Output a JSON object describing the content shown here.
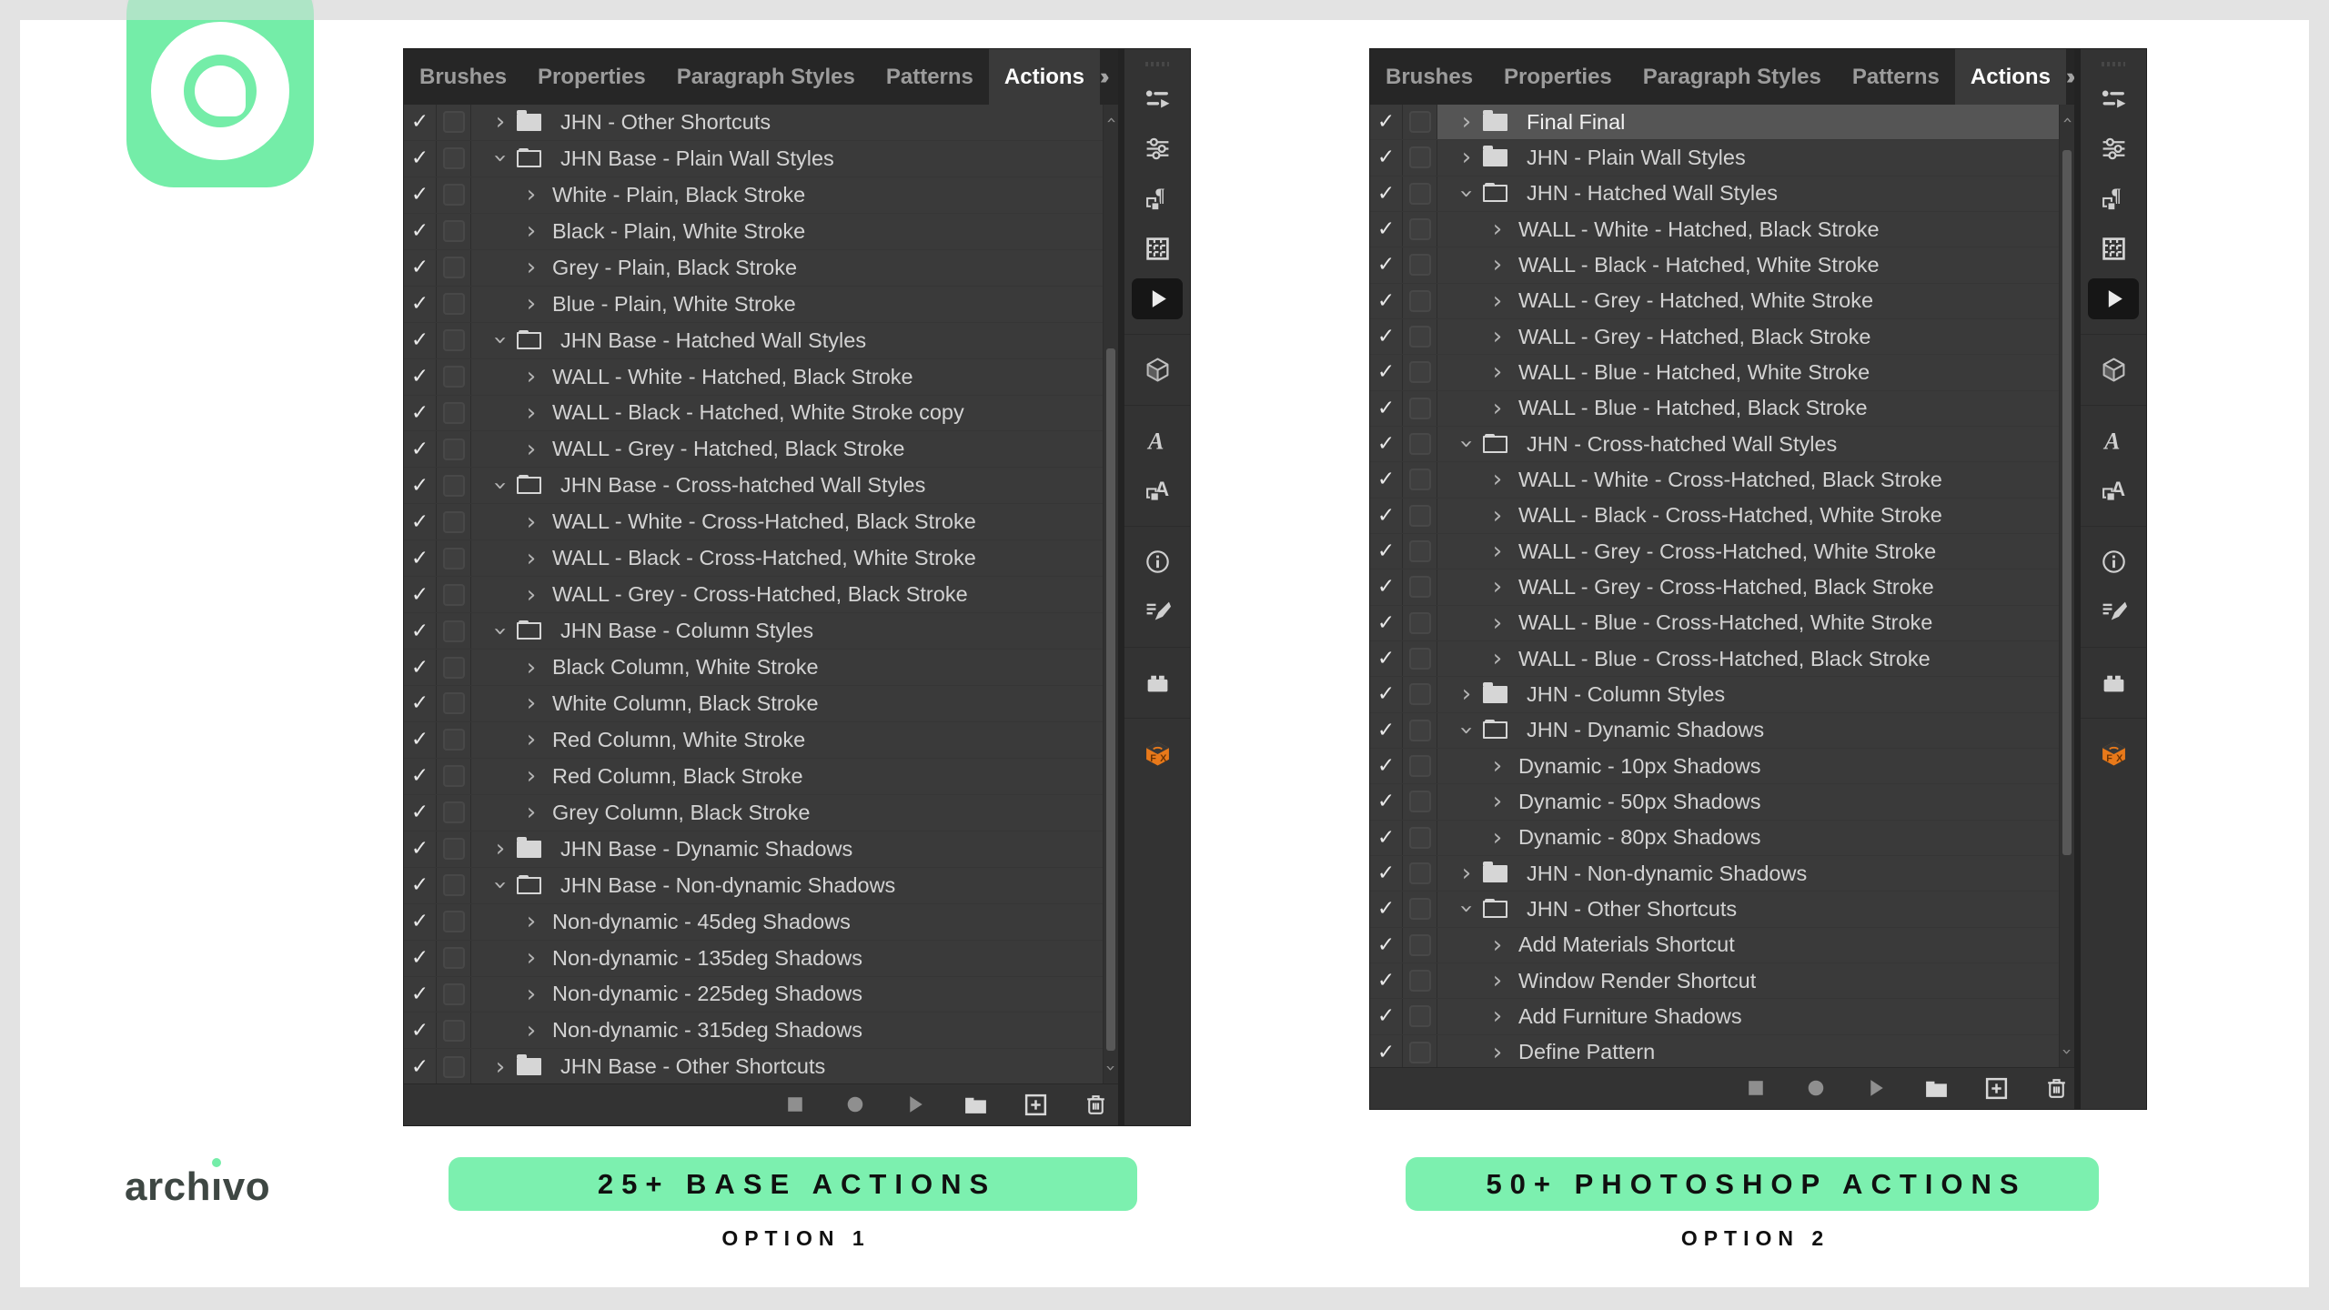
{
  "colors": {
    "green_button": "#7CF0AF",
    "green_icon": "#74EDA8",
    "panel_bg": "#3A3A3A",
    "tabbar_bg": "#262626",
    "toolstrip_bg": "#333333",
    "frame_grey": "#E3E3E3",
    "selected_row": "#555555",
    "fx_orange": "#E8791A",
    "row_text": "#D3D3D3",
    "brand_text": "#3E4743"
  },
  "tabs": {
    "labels": [
      "Brushes",
      "Properties",
      "Paragraph Styles",
      "Patterns",
      "Actions"
    ],
    "active": "Actions"
  },
  "toolstrip": {
    "groups": [
      [
        "brushes",
        "properties",
        "paragraph-styles",
        "patterns",
        "actions"
      ],
      [
        "3d"
      ],
      [
        "glyphs",
        "character-styles"
      ],
      [
        "info",
        "brush-settings"
      ],
      [
        "libraries"
      ],
      [
        "fx-plugin"
      ]
    ],
    "active": "actions"
  },
  "transport": [
    "stop",
    "record",
    "play",
    "new-folder",
    "new-action",
    "delete"
  ],
  "panels": [
    {
      "side": "left",
      "rows": [
        {
          "type": "set",
          "expanded": false,
          "label": "JHN - Other Shortcuts"
        },
        {
          "type": "set",
          "expanded": true,
          "label": "JHN Base - Plain Wall Styles"
        },
        {
          "type": "action",
          "label": "White - Plain, Black Stroke"
        },
        {
          "type": "action",
          "label": "Black - Plain, White Stroke"
        },
        {
          "type": "action",
          "label": "Grey - Plain, Black Stroke"
        },
        {
          "type": "action",
          "label": "Blue - Plain, White Stroke"
        },
        {
          "type": "set",
          "expanded": true,
          "label": "JHN Base - Hatched Wall Styles"
        },
        {
          "type": "action",
          "label": "WALL - White - Hatched, Black Stroke"
        },
        {
          "type": "action",
          "label": "WALL - Black - Hatched, White Stroke copy"
        },
        {
          "type": "action",
          "label": "WALL - Grey - Hatched, Black Stroke"
        },
        {
          "type": "set",
          "expanded": true,
          "label": "JHN Base - Cross-hatched Wall Styles"
        },
        {
          "type": "action",
          "label": "WALL - White - Cross-Hatched, Black Stroke"
        },
        {
          "type": "action",
          "label": "WALL - Black - Cross-Hatched, White Stroke"
        },
        {
          "type": "action",
          "label": "WALL - Grey - Cross-Hatched, Black Stroke"
        },
        {
          "type": "set",
          "expanded": true,
          "label": "JHN Base - Column Styles"
        },
        {
          "type": "action",
          "label": "Black Column, White Stroke"
        },
        {
          "type": "action",
          "label": "White Column, Black Stroke"
        },
        {
          "type": "action",
          "label": "Red Column, White Stroke"
        },
        {
          "type": "action",
          "label": "Red Column, Black Stroke"
        },
        {
          "type": "action",
          "label": "Grey Column, Black Stroke"
        },
        {
          "type": "set",
          "expanded": false,
          "label": "JHN Base - Dynamic Shadows"
        },
        {
          "type": "set",
          "expanded": true,
          "label": "JHN Base - Non-dynamic Shadows"
        },
        {
          "type": "action",
          "label": "Non-dynamic - 45deg Shadows"
        },
        {
          "type": "action",
          "label": "Non-dynamic - 135deg Shadows"
        },
        {
          "type": "action",
          "label": "Non-dynamic - 225deg Shadows"
        },
        {
          "type": "action",
          "label": "Non-dynamic - 315deg Shadows"
        },
        {
          "type": "set",
          "expanded": false,
          "label": "JHN Base - Other Shortcuts"
        }
      ]
    },
    {
      "side": "right",
      "rows": [
        {
          "type": "set",
          "expanded": false,
          "label": "Final Final",
          "selected": true
        },
        {
          "type": "set",
          "expanded": false,
          "label": "JHN - Plain Wall Styles"
        },
        {
          "type": "set",
          "expanded": true,
          "label": "JHN - Hatched Wall Styles"
        },
        {
          "type": "action",
          "label": "WALL - White - Hatched, Black Stroke"
        },
        {
          "type": "action",
          "label": "WALL - Black - Hatched, White Stroke"
        },
        {
          "type": "action",
          "label": "WALL - Grey - Hatched, White Stroke"
        },
        {
          "type": "action",
          "label": "WALL - Grey - Hatched, Black Stroke"
        },
        {
          "type": "action",
          "label": "WALL - Blue - Hatched, White Stroke"
        },
        {
          "type": "action",
          "label": "WALL - Blue - Hatched, Black Stroke"
        },
        {
          "type": "set",
          "expanded": true,
          "label": "JHN - Cross-hatched Wall Styles"
        },
        {
          "type": "action",
          "label": "WALL - White - Cross-Hatched, Black Stroke"
        },
        {
          "type": "action",
          "label": "WALL - Black - Cross-Hatched, White Stroke"
        },
        {
          "type": "action",
          "label": "WALL - Grey - Cross-Hatched, White Stroke"
        },
        {
          "type": "action",
          "label": "WALL - Grey - Cross-Hatched, Black Stroke"
        },
        {
          "type": "action",
          "label": "WALL - Blue - Cross-Hatched, White Stroke"
        },
        {
          "type": "action",
          "label": "WALL - Blue - Cross-Hatched, Black Stroke"
        },
        {
          "type": "set",
          "expanded": false,
          "label": "JHN - Column Styles"
        },
        {
          "type": "set",
          "expanded": true,
          "label": "JHN - Dynamic Shadows"
        },
        {
          "type": "action",
          "label": "Dynamic - 10px Shadows"
        },
        {
          "type": "action",
          "label": "Dynamic - 50px Shadows"
        },
        {
          "type": "action",
          "label": "Dynamic - 80px Shadows"
        },
        {
          "type": "set",
          "expanded": false,
          "label": "JHN - Non-dynamic Shadows"
        },
        {
          "type": "set",
          "expanded": true,
          "label": "JHN - Other Shortcuts"
        },
        {
          "type": "action",
          "label": "Add Materials Shortcut"
        },
        {
          "type": "action",
          "label": "Window Render Shortcut"
        },
        {
          "type": "action",
          "label": "Add Furniture Shadows"
        },
        {
          "type": "action",
          "label": "Define Pattern"
        }
      ]
    }
  ],
  "footer": {
    "brand": "archivo",
    "options": [
      {
        "button": "25+ BASE ACTIONS",
        "label": "OPTION 1"
      },
      {
        "button": "50+ PHOTOSHOP ACTIONS",
        "label": "OPTION 2"
      }
    ]
  }
}
